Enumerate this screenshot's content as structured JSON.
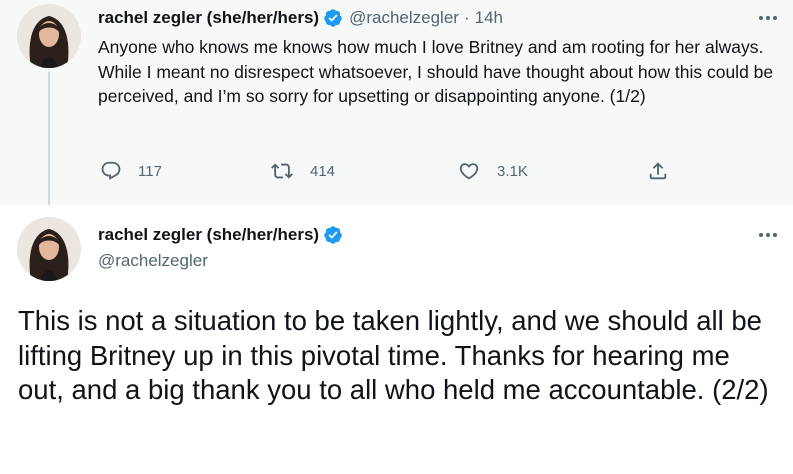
{
  "tweet1": {
    "author_name": "rachel zegler (she/her/hers)",
    "verified_icon": "verified-badge-icon",
    "handle": "@rachelzegler",
    "separator": "·",
    "time": "14h",
    "text": "Anyone who knows me knows how much I love Britney and am rooting for her always. While I meant no disrespect whatsoever, I should have thought about how this could be perceived, and I’m so sorry for upsetting or disappointing anyone. (1/2)",
    "actions": {
      "reply_icon": "reply-icon",
      "reply_count": "117",
      "retweet_icon": "retweet-icon",
      "retweet_count": "414",
      "like_icon": "heart-icon",
      "like_count": "3.1K",
      "share_icon": "share-icon"
    }
  },
  "tweet2": {
    "author_name": "rachel zegler (she/her/hers)",
    "verified_icon": "verified-badge-icon",
    "handle": "@rachelzegler",
    "text": "This is not a situation to be taken lightly, and we should all be lifting Britney up in this pivotal time. Thanks for hearing me out, and a big thank you to all who held me accountable. (2/2)"
  },
  "colors": {
    "accent": "#1d9bf0",
    "secondary_text": "#536471",
    "primary_text": "#0f1419",
    "highlight_bg": "#f7f9f9",
    "thread_line": "#cfd9de"
  }
}
